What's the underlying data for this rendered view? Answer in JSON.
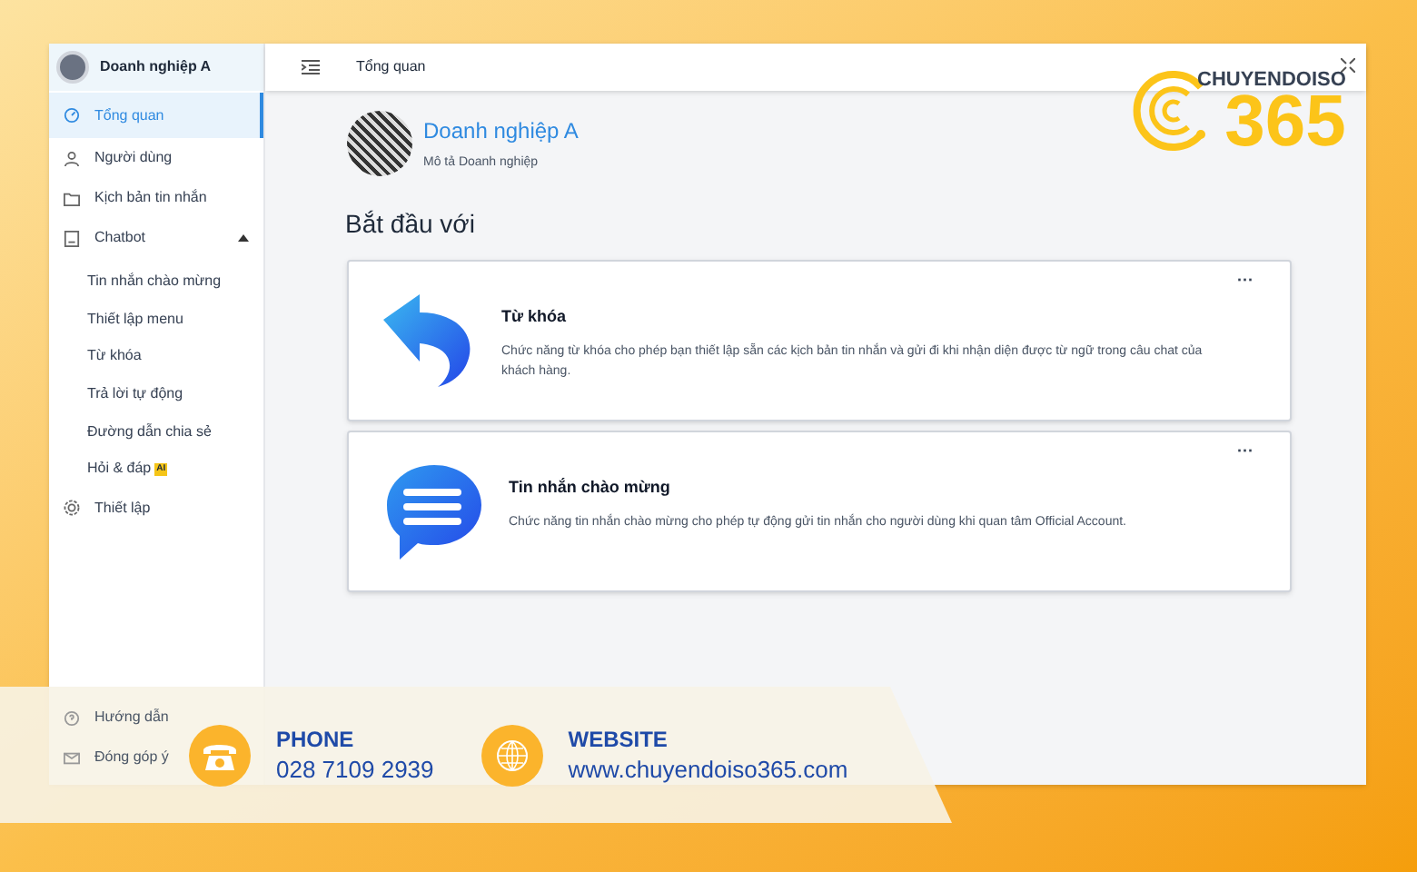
{
  "sidebar": {
    "account": "Doanh nghiệp A",
    "items": [
      {
        "label": "Tổng quan",
        "selected": true
      },
      {
        "label": "Người dùng",
        "selected": false
      },
      {
        "label": "Kịch bản tin nhắn",
        "selected": false
      },
      {
        "label": "Chatbot",
        "selected": false,
        "expanded": true,
        "children": [
          {
            "label": "Tin nhắn chào mừng"
          },
          {
            "label": "Thiết lập menu"
          },
          {
            "label": "Từ khóa"
          },
          {
            "label": "Trả lời tự động"
          },
          {
            "label": "Đường dẫn chia sẻ"
          },
          {
            "label": "Hỏi & đáp",
            "badge": "AI"
          }
        ]
      },
      {
        "label": "Thiết lập",
        "selected": false
      }
    ],
    "bottom_items": [
      {
        "label": "Hướng dẫn"
      },
      {
        "label": "Đóng góp ý"
      }
    ]
  },
  "header": {
    "title": "Tổng quan"
  },
  "profile": {
    "name": "Doanh nghiệp A",
    "description": "Mô tả Doanh nghiệp"
  },
  "section_title": "Bắt đầu với",
  "cards": [
    {
      "kind": "reply",
      "title": "Từ khóa",
      "description": "Chức năng từ khóa cho phép bạn thiết lập sẵn các kịch bản tin nhắn và gửi đi khi nhận diện được từ ngữ trong câu chat của khách hàng.",
      "menu": "···"
    },
    {
      "kind": "message",
      "title": "Tin nhắn chào mừng",
      "description": "Chức năng tin nhắn chào mừng cho phép tự động gửi tin nhắn cho người dùng khi quan tâm Official Account.",
      "menu": "···"
    }
  ],
  "logo": {
    "brand": "CHUYENDOISO",
    "number": "365"
  },
  "contact": [
    {
      "kind": "phone",
      "label": "PHONE",
      "value": "028 7109 2939"
    },
    {
      "kind": "website",
      "label": "WEBSITE",
      "value": "www.chuyendoiso365.com"
    }
  ]
}
